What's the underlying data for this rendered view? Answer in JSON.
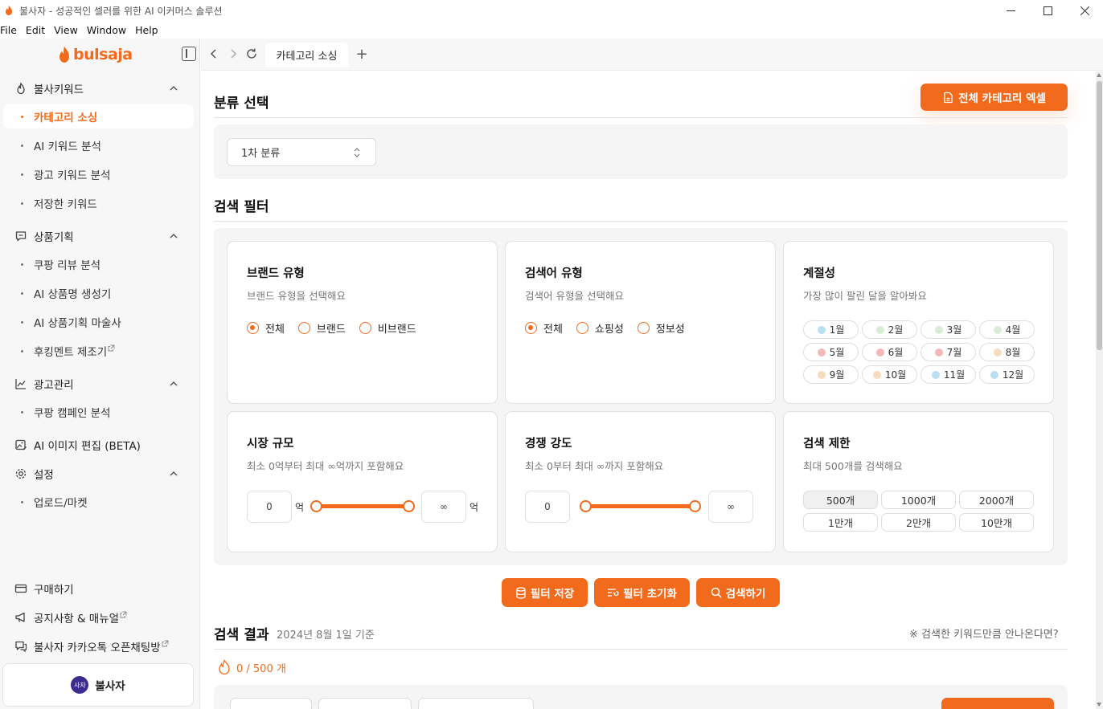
{
  "window": {
    "title": "불사자 - 성공적인 셀러를 위한 AI 이커머스 솔루션"
  },
  "menu": [
    "File",
    "Edit",
    "View",
    "Window",
    "Help"
  ],
  "brand": {
    "logo": "bulsaja",
    "accent": "#f26a1b"
  },
  "sidebar": {
    "sections": [
      {
        "label": "불사키워드",
        "icon": "flame-icon",
        "items": [
          {
            "label": "카테고리 소싱",
            "active": true
          },
          {
            "label": "AI 키워드 분석"
          },
          {
            "label": "광고 키워드 분석"
          },
          {
            "label": "저장한 키워드"
          }
        ]
      },
      {
        "label": "상품기획",
        "icon": "chat-icon",
        "items": [
          {
            "label": "쿠팡 리뷰 분석"
          },
          {
            "label": "AI 상품명 생성기"
          },
          {
            "label": "AI 상품기획 마술사"
          },
          {
            "label": "후킹멘트 제조기",
            "external": true
          }
        ]
      },
      {
        "label": "광고관리",
        "icon": "chart-line-icon",
        "items": [
          {
            "label": "쿠팡 캠페인 분석"
          }
        ]
      },
      {
        "label": "AI 이미지 편집 (BETA)",
        "icon": "image-edit-icon",
        "items": []
      },
      {
        "label": "설정",
        "icon": "gear-icon",
        "items": [
          {
            "label": "업로드/마켓"
          }
        ]
      }
    ],
    "footer": [
      {
        "label": "구매하기",
        "icon": "card-icon"
      },
      {
        "label": "공지사항 & 매뉴얼",
        "icon": "megaphone-icon",
        "external": true
      },
      {
        "label": "불사자 카카오톡 오픈채팅방",
        "icon": "chat-bubble-icon",
        "external": true
      }
    ],
    "profile": {
      "avatar": "사자",
      "name": "불사자"
    }
  },
  "tabs": {
    "active": "카테고리 소싱",
    "add": "+"
  },
  "classify": {
    "title": "분류 선택",
    "export_button": "전체 카테고리 엑셀",
    "select_value": "1차 분류"
  },
  "filters": {
    "title": "검색 필터",
    "brand": {
      "title": "브랜드 유형",
      "desc": "브랜드 유형을 선택해요",
      "options": [
        {
          "label": "전체",
          "checked": true
        },
        {
          "label": "브랜드"
        },
        {
          "label": "비브랜드"
        }
      ]
    },
    "keyword_type": {
      "title": "검색어 유형",
      "desc": "검색어 유형을 선택해요",
      "options": [
        {
          "label": "전체",
          "checked": true
        },
        {
          "label": "쇼핑성"
        },
        {
          "label": "정보성"
        }
      ]
    },
    "season": {
      "title": "계절성",
      "desc": "가장 많이 팔린 달을 알아봐요",
      "months": [
        {
          "label": "1월",
          "color": "#b9e0f2"
        },
        {
          "label": "2월",
          "color": "#d9ecd5"
        },
        {
          "label": "3월",
          "color": "#d9ecd5"
        },
        {
          "label": "4월",
          "color": "#d9ecd5"
        },
        {
          "label": "5월",
          "color": "#f5b8b8"
        },
        {
          "label": "6월",
          "color": "#f5b8b8"
        },
        {
          "label": "7월",
          "color": "#f5b8b8"
        },
        {
          "label": "8월",
          "color": "#f8dcc0"
        },
        {
          "label": "9월",
          "color": "#f8dcc0"
        },
        {
          "label": "10월",
          "color": "#f8dcc0"
        },
        {
          "label": "11월",
          "color": "#b9e0f2"
        },
        {
          "label": "12월",
          "color": "#b9e0f2"
        }
      ]
    },
    "market_size": {
      "title": "시장 규모",
      "desc": "최소 0억부터 최대 ∞억까지 포함해요",
      "min": "0",
      "max": "∞",
      "unit": "억"
    },
    "competition": {
      "title": "경쟁 강도",
      "desc": "최소 0부터 최대 ∞까지 포함해요",
      "min": "0",
      "max": "∞"
    },
    "limit": {
      "title": "검색 제한",
      "desc": "최대 500개를 검색해요",
      "options": [
        {
          "label": "500개",
          "selected": true
        },
        {
          "label": "1000개"
        },
        {
          "label": "2000개"
        },
        {
          "label": "1만개"
        },
        {
          "label": "2만개"
        },
        {
          "label": "10만개"
        }
      ]
    }
  },
  "actions": {
    "save": "필터 저장",
    "reset": "필터 초기화",
    "search": "검색하기"
  },
  "results": {
    "title": "검색 결과",
    "date": "2024년 8월 1일 기준",
    "help_link": "※ 검색한 키워드만큼 안나온다면?",
    "count": "0 / 500 개"
  }
}
